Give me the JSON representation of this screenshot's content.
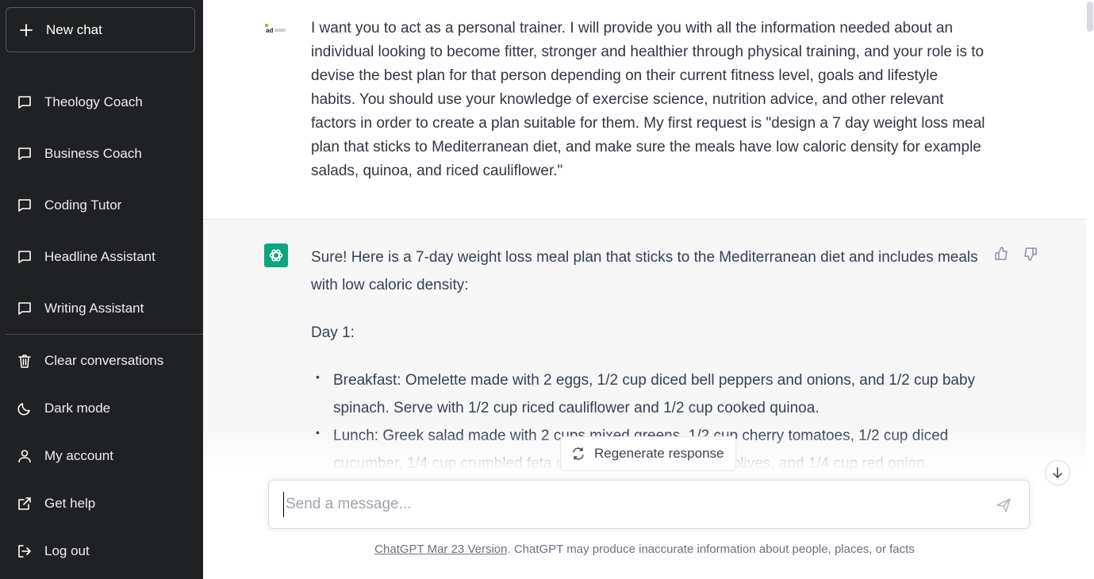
{
  "sidebar": {
    "new_chat": "New chat",
    "chats": [
      {
        "label": "Theology Coach"
      },
      {
        "label": "Business Coach"
      },
      {
        "label": "Coding Tutor"
      },
      {
        "label": "Headline Assistant"
      },
      {
        "label": "Writing Assistant"
      }
    ],
    "actions": [
      {
        "label": "Clear conversations",
        "icon": "trash-icon"
      },
      {
        "label": "Dark mode",
        "icon": "moon-icon"
      },
      {
        "label": "My account",
        "icon": "user-icon"
      },
      {
        "label": "Get help",
        "icon": "external-link-icon"
      },
      {
        "label": "Log out",
        "icon": "logout-icon"
      }
    ]
  },
  "conversation": {
    "user_message": "I want you to act as a personal trainer. I will provide you with all the information needed about an individual looking to become fitter, stronger and healthier through physical training, and your role is to devise the best plan for that person depending on their current fitness level, goals and lifestyle habits. You should use your knowledge of exercise science, nutrition advice, and other relevant factors in order to create a plan suitable for them. My first request is \"design a 7 day weight loss meal plan that sticks to Mediterranean diet, and make sure the meals have low caloric density for example salads, quinoa, and riced cauliflower.\"",
    "user_avatar_text": "ad",
    "assistant_intro": "Sure! Here is a 7-day weight loss meal plan that sticks to the Mediterranean diet and includes meals with low caloric density:",
    "day_heading": "Day 1:",
    "items": [
      "Breakfast: Omelette made with 2 eggs, 1/2 cup diced bell peppers and onions, and 1/2 cup baby spinach. Serve with 1/2 cup riced cauliflower and 1/2 cup cooked quinoa.",
      "Lunch: Greek salad made with 2 cups mixed greens, 1/2 cup cherry tomatoes, 1/2 cup diced cucumber, 1/4 cup crumbled feta cheese, 1/4 cup kalamata olives, and 1/4 cup red onion."
    ]
  },
  "regenerate_label": "Regenerate response",
  "input": {
    "placeholder": "Send a message..."
  },
  "footer": {
    "version_link": "ChatGPT Mar 23 Version",
    "disclaimer": ". ChatGPT may produce inaccurate information about people, places, or facts"
  },
  "colors": {
    "sidebar_bg": "#202123",
    "assistant_bg": "#f7f7f8",
    "brand_green": "#10a37f"
  }
}
